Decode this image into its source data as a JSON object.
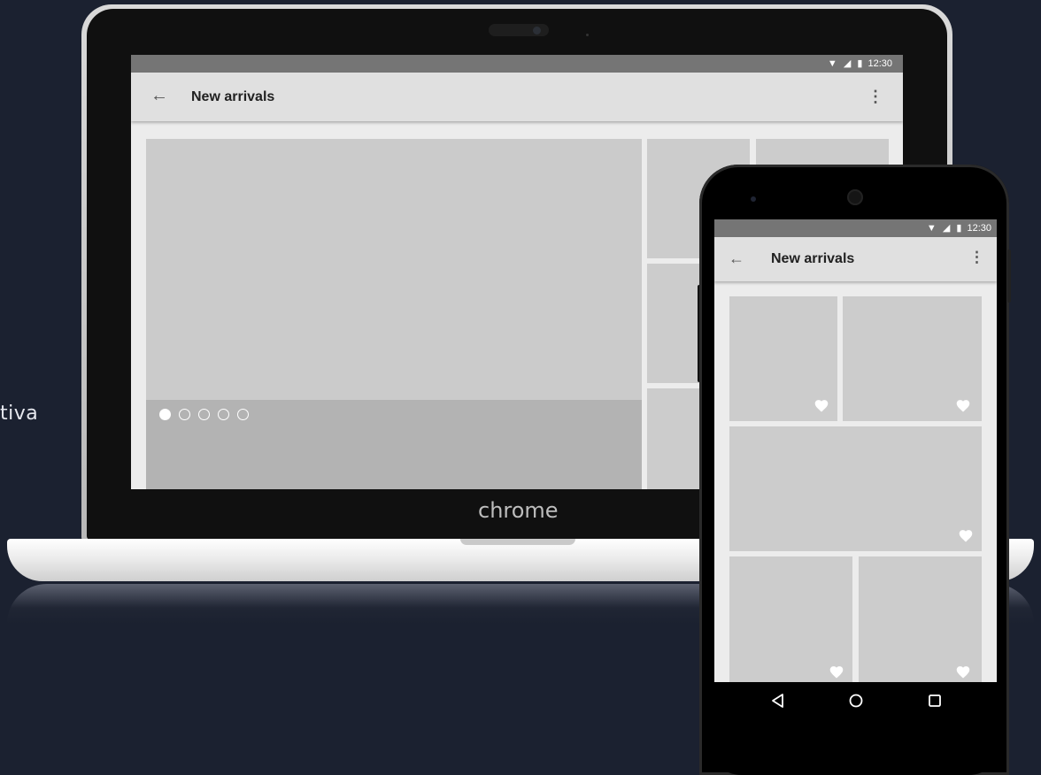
{
  "side_text": "tiva",
  "laptop": {
    "brand_label": "chrome",
    "status_time": "12:30",
    "app_title": "New arrivals",
    "carousel_pages": 5,
    "carousel_active_index": 0
  },
  "phone": {
    "status_time": "12:30",
    "app_title": "New arrivals"
  },
  "icons": {
    "back": "arrow-back-icon",
    "more": "more-vert-icon",
    "favorite": "heart-icon",
    "wifi": "wifi-icon",
    "signal": "signal-icon",
    "battery": "battery-icon",
    "nav_back": "triangle-back-icon",
    "nav_home": "circle-home-icon",
    "nav_recents": "square-recents-icon"
  },
  "colors": {
    "background": "#1b2130",
    "status_bar": "#757575",
    "app_bar": "#e0e0e0",
    "tile": "#cccccc",
    "caption": "#b3b3b3"
  }
}
